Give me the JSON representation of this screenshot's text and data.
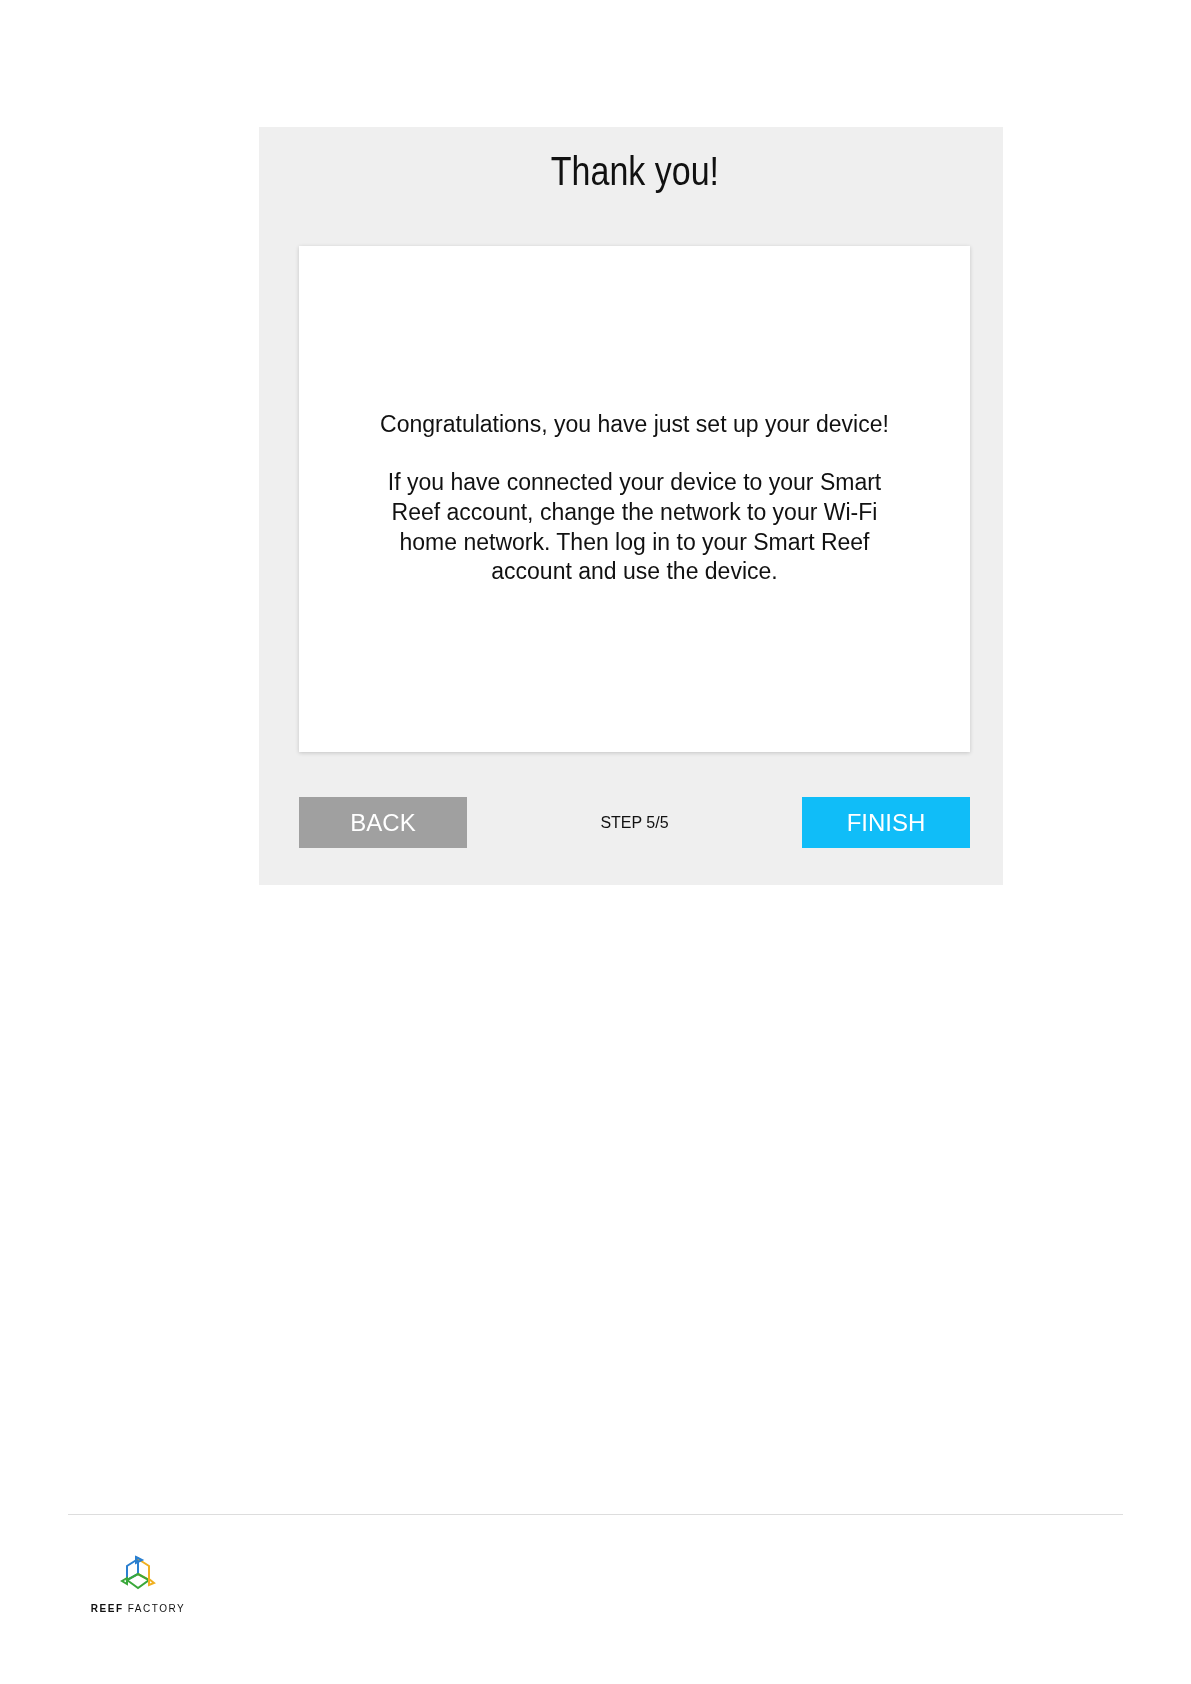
{
  "dialog": {
    "title": "Thank you!",
    "message": "Congratulations, you have just set up your device!",
    "details": "If you have connected your device to your Smart Reef account, change the network to your Wi-Fi home network. Then log in to your Smart Reef account and use the device.",
    "back_button": "BACK",
    "step": "STEP 5/5",
    "finish_button": "FINISH"
  },
  "footer": {
    "logo_text": "**REEF** FACTORY"
  }
}
